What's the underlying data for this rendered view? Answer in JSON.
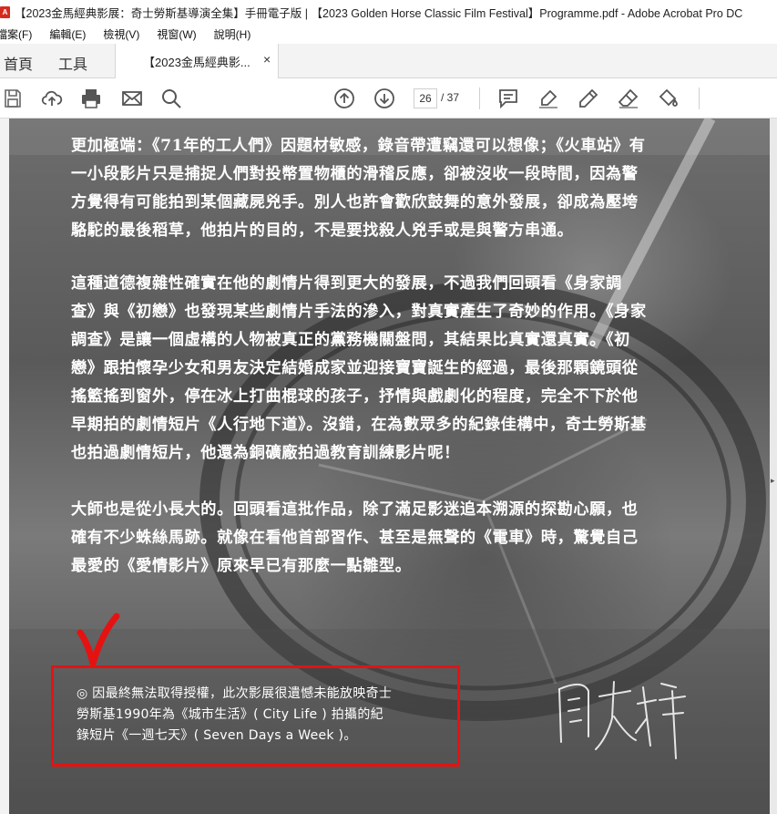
{
  "window": {
    "title": "【2023金馬經典影展：奇士勞斯基導演全集】手冊電子版 | 【2023 Golden Horse Classic Film Festival】Programme.pdf - Adobe Acrobat Pro DC",
    "app_icon": "acrobat-icon"
  },
  "menu": [
    "檔案(F)",
    "編輯(E)",
    "檢視(V)",
    "視窗(W)",
    "說明(H)"
  ],
  "tabs": {
    "home": "首頁",
    "tools": "工具",
    "document": "【2023金馬經典影...",
    "close_symbol": "×"
  },
  "toolbar": {
    "icons": [
      "save-icon",
      "upload-icon",
      "print-icon",
      "email-icon",
      "search-icon",
      "page-up-icon",
      "page-down-icon",
      "comment-icon",
      "highlight-icon",
      "pen-icon",
      "eraser-icon",
      "fill-icon"
    ],
    "current_page": "26",
    "total_pages": "/ 37"
  },
  "document": {
    "paragraph1": [
      "更加極端：《71年的工人們》因題材敏感，錄音帶遭竊還可以想像；《火車站》有",
      "一小段影片只是捕捉人們對投幣置物櫃的滑稽反應，卻被沒收一段時間，因為警",
      "方覺得有可能拍到某個藏屍兇手。別人也許會歡欣鼓舞的意外發展，卻成為壓垮",
      "駱駝的最後稻草，他拍片的目的，不是要找殺人兇手或是與警方串通。"
    ],
    "paragraph2": [
      "這種道德複雜性確實在他的劇情片得到更大的發展，不過我們回頭看《身家調",
      "查》與《初戀》也發現某些劇情片手法的滲入，對真實產生了奇妙的作用。《身家",
      "調查》是讓一個虛構的人物被真正的黨務機關盤問，其結果比真實還真實。《初",
      "戀》跟拍懷孕少女和男友決定結婚成家並迎接寶寶誕生的經過，最後那顆鏡頭從",
      "搖籃搖到窗外，停在冰上打曲棍球的孩子，抒情與戲劇化的程度，完全不下於他",
      "早期拍的劇情短片《人行地下道》。沒錯，在為數眾多的紀錄佳構中，奇士勞斯基",
      "也拍過劇情短片，他還為銅礦廠拍過教育訓練影片呢！"
    ],
    "paragraph3": [
      "大師也是從小長大的。回頭看這批作品，除了滿足影迷追本溯源的探勘心願，也",
      "確有不少蛛絲馬跡。就像在看他首部習作、甚至是無聲的《電車》時，驚覺自己",
      "最愛的《愛情影片》原來早已有那麼一點雛型。"
    ],
    "note": [
      "◎ 因最終無法取得授權，此次影展很遺憾未能放映奇士",
      "勞斯基1990年為《城市生活》( City Life ) 拍攝的紀",
      "錄短片《一週七天》( Seven Days a Week )。"
    ],
    "signature": "聞天祥"
  },
  "annotation": {
    "color": "#e51212"
  }
}
